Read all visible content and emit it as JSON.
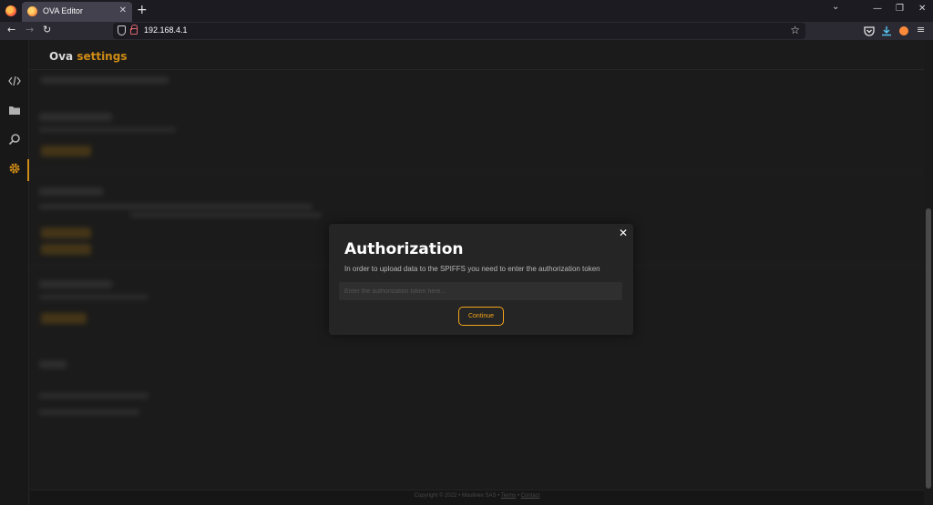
{
  "browser": {
    "tab_title": "OVA Editor",
    "tab_close": "✕",
    "new_tab": "+",
    "url": "192.168.4.1",
    "window_controls": {
      "dropdown": "⌄",
      "minimize": "—",
      "restore": "❐",
      "close": "✕"
    },
    "nav": {
      "back": "←",
      "forward": "→",
      "reload": "↻",
      "bookmark": "☆",
      "menu": "≡"
    }
  },
  "app": {
    "brand_primary": "Ova",
    "brand_secondary": "settings",
    "accent_color": "#f3a419",
    "sidebar_items": [
      {
        "name": "code",
        "icon": "code-icon",
        "active": false
      },
      {
        "name": "files",
        "icon": "folder-icon",
        "active": false
      },
      {
        "name": "search",
        "icon": "search-icon",
        "active": false
      },
      {
        "name": "settings",
        "icon": "gear-icon",
        "active": true
      }
    ],
    "footer": {
      "copyright": "Copyright © 2022 • Moulinex SAS •",
      "terms": "Terms",
      "sep": "•",
      "contact": "Contact"
    }
  },
  "modal": {
    "title": "Authorization",
    "description": "In order to upload data to the SPIFFS you need to enter the authorization token",
    "input_placeholder": "Enter the authorization token here...",
    "input_value": "",
    "continue_label": "Continue",
    "close_label": "✕"
  }
}
